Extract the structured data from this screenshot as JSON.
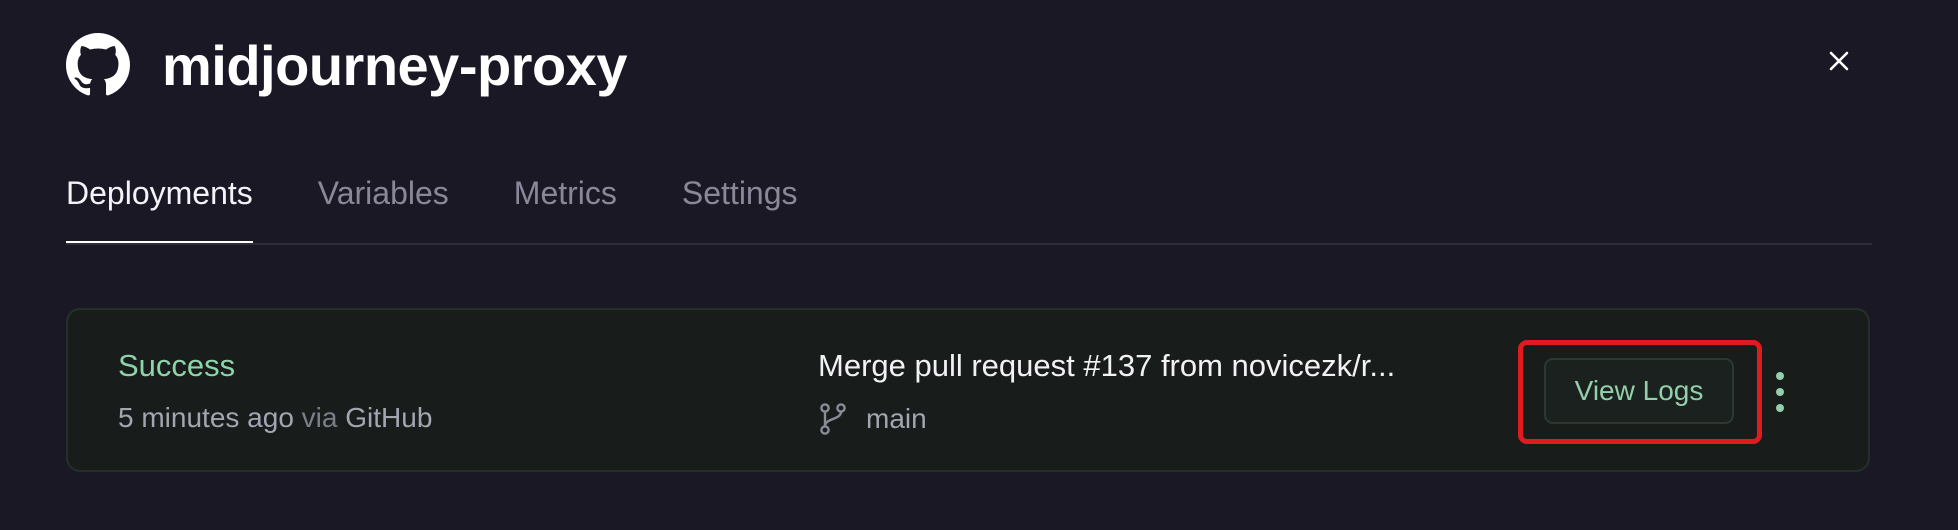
{
  "project": {
    "name": "midjourney-proxy",
    "icon": "github-icon"
  },
  "close": {
    "icon": "close-icon"
  },
  "tabs": [
    {
      "label": "Deployments",
      "active": true
    },
    {
      "label": "Variables",
      "active": false
    },
    {
      "label": "Metrics",
      "active": false
    },
    {
      "label": "Settings",
      "active": false
    }
  ],
  "deployment": {
    "status": "Success",
    "time_ago": "5 minutes ago",
    "via_label": "via",
    "source": "GitHub",
    "commit_message": "Merge pull request #137 from novicezk/r...",
    "branch": "main",
    "branch_icon": "git-branch-icon",
    "view_logs_label": "View Logs",
    "more_icon": "more-vertical-icon"
  },
  "colors": {
    "background": "#1a1825",
    "success": "#8fd3a8",
    "highlight": "#e01b1f",
    "card_background": "#181d1c"
  }
}
